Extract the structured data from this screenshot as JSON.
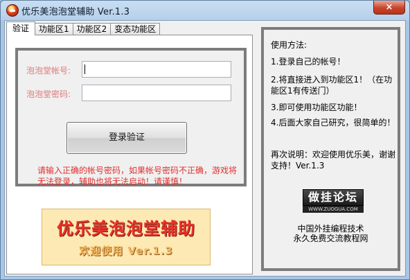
{
  "window": {
    "title": "优乐美泡泡堂辅助 Ver.1.3",
    "close_glyph": "×"
  },
  "tabs": [
    "验证",
    "功能区1",
    "功能区2",
    "变态功能区"
  ],
  "login": {
    "account_label": "泡泡堂帐号:",
    "password_label": "泡泡堂密码:",
    "account_value": "",
    "password_value": "",
    "button_label": "登录验证",
    "warning": "请输入正确的帐号密码，如果帐号密码不正确，游戏将无法登录，辅助也将无法启动！请谨慎！"
  },
  "banner": {
    "title": "优乐美泡泡堂辅助",
    "subtitle": "欢迎使用 Ver.1.3"
  },
  "help": {
    "title": "使用方法:",
    "steps": [
      "1.登录自己的帐号！",
      "2.将直接进入到功能区1！（在功能区1有传送门）",
      "3.即可使用功能区功能！",
      "4.后面大家自己研究，很简单的！",
      "再次说明：欢迎使用优乐美，谢谢支持！Ver.1.3"
    ],
    "logo_text": "做挂论坛",
    "logo_url": "WWW.ZUOGUA.COM",
    "tagline1": "中国外挂编程技术",
    "tagline2": "永久免费交流教程网"
  },
  "colors": {
    "label_pink": "#e07878",
    "warning_red": "#e03030",
    "banner_bg": "#fde9b3",
    "banner_title": "#e8342a",
    "banner_sub": "#f6b85e"
  }
}
